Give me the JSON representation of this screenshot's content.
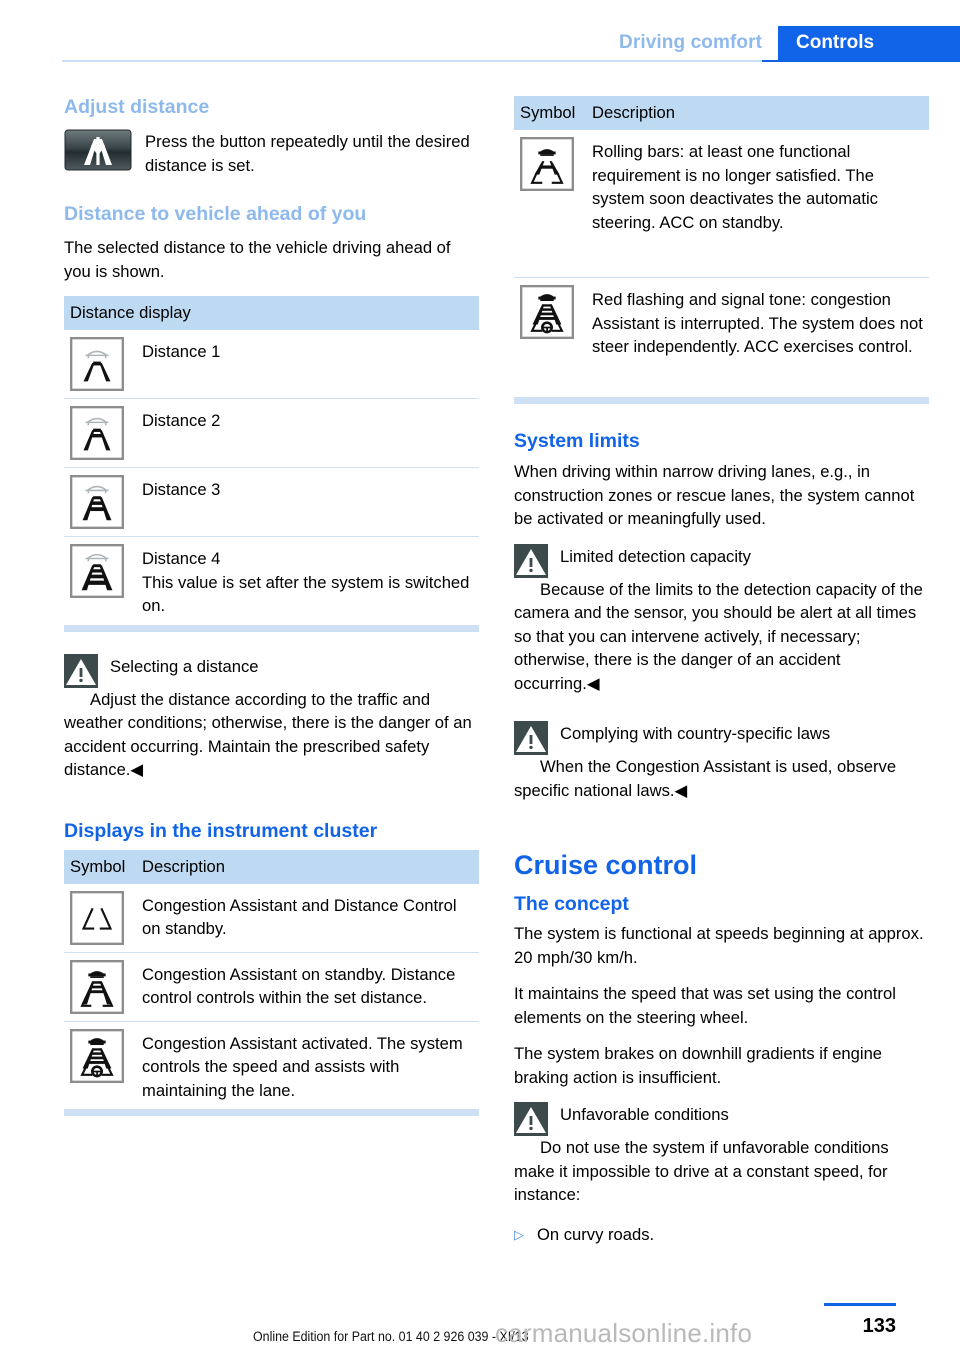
{
  "header": {
    "chapter": "Driving comfort",
    "section": "Controls",
    "chapter_color": "#8eb9ec",
    "section_bg": "#1163e8"
  },
  "left_column": {
    "adjust_distance": {
      "heading": "Adjust distance",
      "icon": "highway-distance-button-icon",
      "text": "Press the button repeatedly until the desired distance is set."
    },
    "distance_to_vehicle": {
      "heading": "Distance to vehicle ahead of you",
      "text": "The selected distance to the vehicle driving ahead of you is shown."
    },
    "distance_table": {
      "header": "Distance display",
      "rows": [
        {
          "icon": "distance-1-icon",
          "bars": 1,
          "label": "Distance 1",
          "note": ""
        },
        {
          "icon": "distance-2-icon",
          "bars": 2,
          "label": "Distance 2",
          "note": ""
        },
        {
          "icon": "distance-3-icon",
          "bars": 3,
          "label": "Distance 3",
          "note": ""
        },
        {
          "icon": "distance-4-icon",
          "bars": 4,
          "label": "Distance 4",
          "note": "This value is set after the system is switched on."
        }
      ]
    },
    "warning_select_distance": {
      "icon": "warning-triangle-icon",
      "title": "Selecting a distance",
      "body": "Adjust the distance according to the traffic and weather conditions; otherwise, there is the danger of an accident occurring. Maintain the prescribed safety distance.◀"
    },
    "instrument_cluster": {
      "heading": "Displays in the instrument cluster",
      "table": {
        "col1": "Symbol",
        "col2": "Description",
        "rows": [
          {
            "icon": "lane-markers-standby-icon",
            "text": "Congestion Assistant and Distance Control on standby."
          },
          {
            "icon": "congestion-standby-icon",
            "text": "Congestion Assistant on standby. Distance control controls within the set distance."
          },
          {
            "icon": "congestion-active-icon",
            "text": "Congestion Assistant activated. The system controls the speed and assists with maintaining the lane."
          }
        ]
      }
    }
  },
  "right_column": {
    "symbol_table": {
      "col1": "Symbol",
      "col2": "Description",
      "rows": [
        {
          "icon": "rolling-bars-icon",
          "text": "Rolling bars: at least one functional requirement is no longer satisfied. The system soon deactivates the automatic steering. ACC on standby."
        },
        {
          "icon": "red-flashing-icon",
          "text": "Red flashing and signal tone: congestion Assistant is interrupted. The system does not steer independently. ACC exercises control."
        }
      ]
    },
    "system_limits": {
      "heading": "System limits",
      "text": "When driving within narrow driving lanes, e.g., in construction zones or rescue lanes, the system cannot be activated or meaningfully used.",
      "warning": {
        "icon": "warning-triangle-icon",
        "title": "Limited detection capacity",
        "body": "Because of the limits to the detection capacity of the camera and the sensor, you should be alert at all times so that you can intervene actively, if necessary; otherwise, there is the danger of an accident occurring.◀"
      },
      "warning2": {
        "icon": "warning-triangle-icon",
        "title": "Complying with country-specific laws",
        "body": "When the Congestion Assistant is used, observe specific national laws.◀"
      }
    },
    "cruise_control": {
      "heading": "Cruise control",
      "concept_heading": "The concept",
      "paragraphs": [
        "The system is functional at speeds beginning at approx. 20 mph/30 km/h.",
        "It maintains the speed that was set using the control elements on the steering wheel.",
        "The system brakes on downhill gradients if engine braking action is insufficient."
      ],
      "warning": {
        "icon": "warning-triangle-icon",
        "title": "Unfavorable conditions",
        "body": "Do not use the system if unfavorable conditions make it impossible to drive at a constant speed, for instance:"
      },
      "bullets": [
        {
          "marker": "▷",
          "text": "On curvy roads."
        }
      ]
    }
  },
  "footer": {
    "edition": "Online Edition for Part no. 01 40 2 926 039 - XI/13",
    "watermark": "carmanualsonline.info",
    "page_number": "133"
  }
}
